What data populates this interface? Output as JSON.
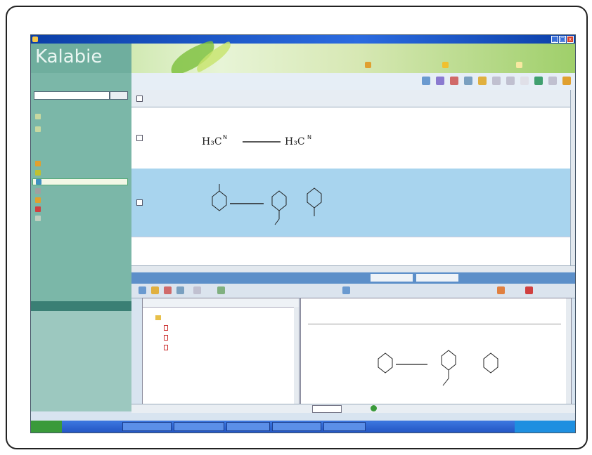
{
  "window": {
    "title": "",
    "buttons": [
      "_",
      "□",
      "x"
    ]
  },
  "banner": {
    "logo": "Kalabie",
    "user_info": "",
    "buttons": [
      "",
      "",
      ""
    ]
  },
  "sidebar": {
    "quick_search_title": "",
    "go_label": "",
    "links": [
      "",
      ""
    ],
    "nav_items": [
      {
        "label": "",
        "selected": false,
        "color": "#e0a030"
      },
      {
        "label": "",
        "selected": false,
        "color": "#c0c030"
      },
      {
        "label": "",
        "selected": true,
        "color": "#4090c0"
      },
      {
        "label": "",
        "selected": false,
        "color": "#a0a0a0"
      },
      {
        "label": "",
        "selected": false,
        "color": "#e0a030"
      },
      {
        "label": "",
        "selected": false,
        "color": "#d04040"
      },
      {
        "label": "",
        "selected": false,
        "color": "#c0d0c0"
      }
    ],
    "section_title": ""
  },
  "main": {
    "toolbar_label": "",
    "toolbar_select": [
      "",
      ""
    ]
  },
  "table": {
    "columns": [
      "",
      "",
      "",
      "",
      "",
      "",
      ""
    ],
    "rows": [
      {
        "link": "",
        "date": "",
        "extra": "",
        "selected": false
      },
      {
        "link": "",
        "date": "",
        "extra": "",
        "selected": true
      }
    ]
  },
  "preview": {
    "title": "",
    "tabs": [
      "",
      ""
    ],
    "tree": {
      "root": "",
      "items": [
        "",
        "",
        ""
      ]
    },
    "doc_header": [
      ""
    ],
    "page_value": ""
  },
  "taskbar": {
    "start": "",
    "tasks": [
      "",
      "",
      "",
      "",
      ""
    ],
    "clock": ""
  },
  "colors": {
    "selected_row": "#a8d4ee",
    "sidebar": "#7bb7a8",
    "title_bar": "#2b6be0"
  }
}
